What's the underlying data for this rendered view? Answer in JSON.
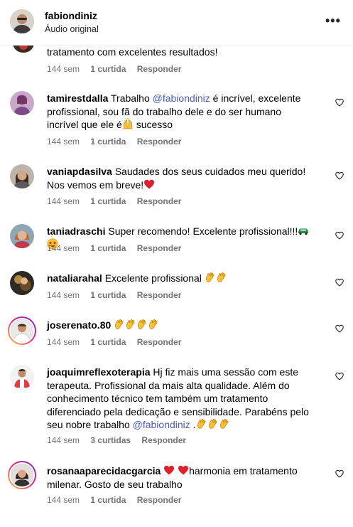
{
  "header": {
    "username": "fabiondiniz",
    "subtitle": "Áudio original",
    "more": "•••"
  },
  "top_partial": {
    "text": "tratamento com excelentes resultados!",
    "time": "144 sem",
    "likes": "1 curtida",
    "reply": "Responder"
  },
  "comments": [
    {
      "user": "tamirestdalla",
      "pre": " Trabalho ",
      "mention": "@fabiondiniz",
      "post": " é incrível, excelente profissional, sou fã do trabalho dele e do ser humano incrível que ele é",
      "post2": " sucesso",
      "emoji": "raising-hands",
      "time": "144 sem",
      "likes": "1 curtida",
      "reply": "Responder"
    },
    {
      "user": "vaniapdasilva",
      "text": " Saudades dos seus cuidados meu querido! Nos vemos em breve!",
      "emoji": "red-heart",
      "time": "144 sem",
      "likes": "1 curtida",
      "reply": "Responder"
    },
    {
      "user": "taniadraschi",
      "text": " Super recomendo! Excelente profissional!!!",
      "emoji": "car-and-star-eyes",
      "time": "144 sem",
      "likes": "1 curtida",
      "reply": "Responder"
    },
    {
      "user": "nataliarahal",
      "text": " Excelente profissional ",
      "emoji": "clapping-hands-x2",
      "time": "144 sem",
      "likes": "1 curtida",
      "reply": "Responder"
    },
    {
      "user": "joserenato.80",
      "text": " ",
      "emoji": "clapping-hands-x4",
      "time": "144 sem",
      "likes": "1 curtida",
      "reply": "Responder"
    },
    {
      "user": "joaquimreflexoterapia",
      "text": " Hj fiz mais uma sessão com este terapeuta. Profissional da mais alta qualidade. Além do conhecimento técnico tem também um tratamento diferenciado pela dedicação e sensibilidade. Parabéns pelo seu nobre trabalho ",
      "mention": "@fabiondiniz",
      "post": " .",
      "emoji": "clapping-hands-x3",
      "time": "144 sem",
      "likes": "3 curtidas",
      "reply": "Responder"
    },
    {
      "user": "rosanaaparecidacgarcia",
      "text": "harmonia em tratamento milenar. Gosto de seu trabalho",
      "emoji": "red-heart-x2",
      "time": "144 sem",
      "likes": "1 curtida",
      "reply": "Responder"
    }
  ],
  "colors": {
    "meta": "#737373",
    "mention": "#4a5bb5",
    "story_ring_start": "#f9ce34",
    "story_ring_end": "#c13584"
  },
  "icons": [
    "more-icon",
    "heart-outline-icon"
  ]
}
